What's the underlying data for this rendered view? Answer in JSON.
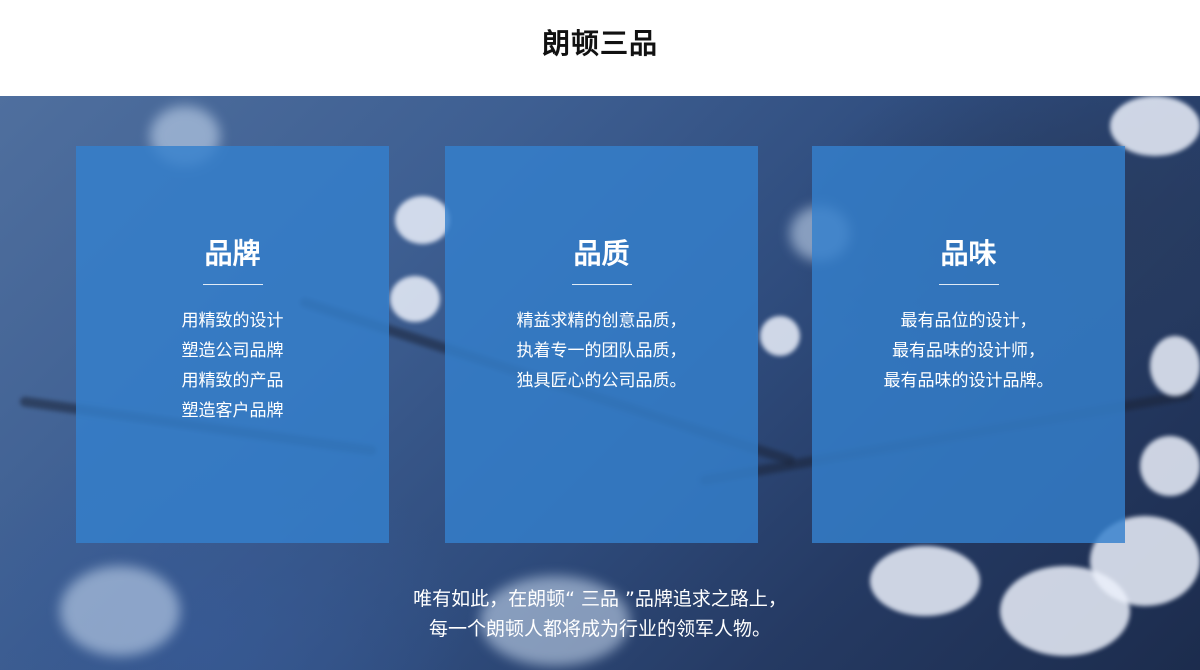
{
  "header": {
    "title": "朗顿三品"
  },
  "cards": [
    {
      "title": "品牌",
      "lines": [
        "用精致的设计",
        "塑造公司品牌",
        "用精致的产品",
        "塑造客户品牌"
      ]
    },
    {
      "title": "品质",
      "lines": [
        "精益求精的创意品质，",
        "执着专一的团队品质，",
        "独具匠心的公司品质。"
      ]
    },
    {
      "title": "品味",
      "lines": [
        "最有品位的设计，",
        "最有品味的设计师，",
        "最有品味的设计品牌。"
      ]
    }
  ],
  "footer": {
    "lines": [
      "唯有如此，在朗顿“ 三品 ”品牌追求之路上，",
      "每一个朗顿人都将成为行业的领军人物。"
    ]
  }
}
